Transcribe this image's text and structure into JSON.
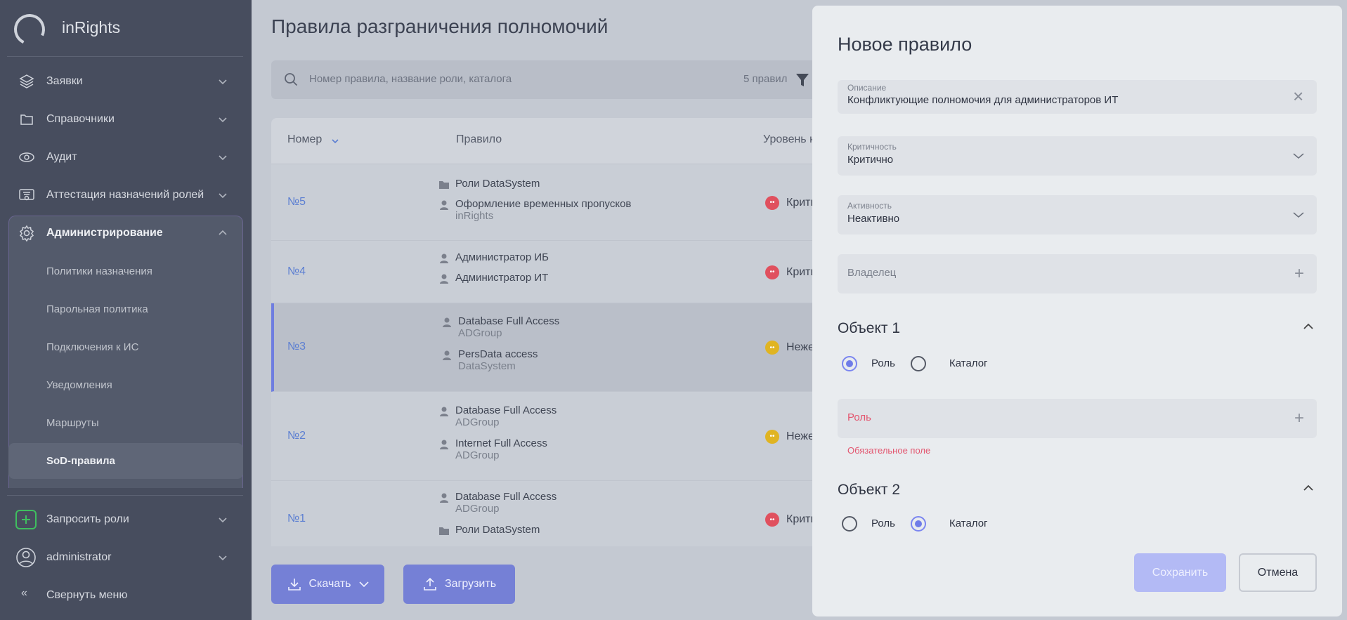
{
  "sidebar": {
    "brand": "inRights",
    "items": [
      {
        "label": "Заявки",
        "icon": "layers-icon"
      },
      {
        "label": "Справочники",
        "icon": "folder-icon"
      },
      {
        "label": "Аудит",
        "icon": "eye-icon"
      },
      {
        "label": "Аттестация назначений ролей",
        "icon": "certificate-icon"
      },
      {
        "label": "Администрирование",
        "icon": "gear-icon"
      }
    ],
    "admin_sub": [
      "Политики назначения",
      "Парольная политика",
      "Подключения к ИС",
      "Уведомления",
      "Маршруты",
      "SoD-правила"
    ],
    "request_roles": "Запросить роли",
    "user": "administrator",
    "collapse": "Свернуть меню"
  },
  "main": {
    "title": "Правила разграничения полномочий",
    "search_placeholder": "Номер правила, название роли, каталога",
    "count": "5 правил",
    "columns": [
      "Номер",
      "Правило",
      "Уровень к"
    ],
    "rows": [
      {
        "num": "№5",
        "entries": [
          {
            "icon": "folder",
            "name": "Роли DataSystem",
            "sub": ""
          },
          {
            "icon": "user",
            "name": "Оформление временных пропусков",
            "sub": "inRights"
          }
        ],
        "level": "Крити",
        "color": "#e0505e"
      },
      {
        "num": "№4",
        "entries": [
          {
            "icon": "user",
            "name": "Администратор ИБ",
            "sub": ""
          },
          {
            "icon": "user",
            "name": "Администратор ИТ",
            "sub": ""
          }
        ],
        "level": "Крити",
        "color": "#e0505e"
      },
      {
        "num": "№3",
        "entries": [
          {
            "icon": "user",
            "name": "Database Full Access",
            "sub": "ADGroup"
          },
          {
            "icon": "user",
            "name": "PersData access",
            "sub": "DataSystem"
          }
        ],
        "level": "Нежел",
        "color": "#e0b422"
      },
      {
        "num": "№2",
        "entries": [
          {
            "icon": "user",
            "name": "Database Full Access",
            "sub": "ADGroup"
          },
          {
            "icon": "user",
            "name": "Internet Full Access",
            "sub": "ADGroup"
          }
        ],
        "level": "Нежел",
        "color": "#e0b422"
      },
      {
        "num": "№1",
        "entries": [
          {
            "icon": "user",
            "name": "Database Full Access",
            "sub": "ADGroup"
          },
          {
            "icon": "folder",
            "name": "Роли DataSystem",
            "sub": ""
          }
        ],
        "level": "Крити",
        "color": "#e0505e"
      }
    ],
    "download": "Скачать",
    "upload": "Загрузить"
  },
  "panel": {
    "title": "Новое правило",
    "description": {
      "label": "Описание",
      "value": "Конфликтующие полномочия для администраторов ИТ"
    },
    "criticality": {
      "label": "Критичность",
      "value": "Критично"
    },
    "activity": {
      "label": "Активность",
      "value": "Неактивно"
    },
    "owner": {
      "placeholder": "Владелец"
    },
    "object1": {
      "title": "Объект 1",
      "options": [
        "Роль",
        "Каталог"
      ],
      "selected": "Роль",
      "field": "Роль",
      "error": "Обязательное поле"
    },
    "object2": {
      "title": "Объект 2",
      "options": [
        "Роль",
        "Каталог"
      ],
      "selected": "Каталог"
    },
    "save": "Сохранить",
    "cancel": "Отмена"
  },
  "colors": {
    "accent": "#7580d6",
    "critical": "#e0505e",
    "warning": "#e0b422",
    "error": "#e3566f"
  }
}
